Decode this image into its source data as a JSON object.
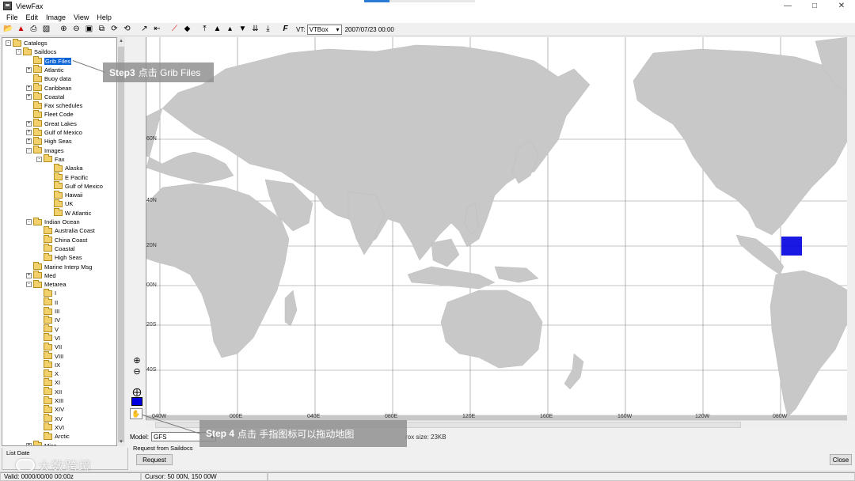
{
  "window": {
    "title": "ViewFax",
    "controls": {
      "minimize": "—",
      "maximize": "□",
      "close": "✕"
    }
  },
  "menu": [
    "File",
    "Edit",
    "Image",
    "View",
    "Help"
  ],
  "toolbar": {
    "icons": [
      "open-icon",
      "fax-icon",
      "print-icon",
      "delete-icon",
      "zoom-in-icon",
      "zoom-out-icon",
      "zoom-fit-icon",
      "copy-icon",
      "rotate-icon",
      "refresh-icon",
      "cursor-icon",
      "left-edge-icon",
      "draw-line-icon",
      "diamond-icon",
      "top-align-icon",
      "mountain-icon",
      "triangle-up-icon",
      "triangle-down-icon",
      "double-down-icon",
      "bottom-align-icon",
      "font-icon"
    ],
    "vt_label": "VT:",
    "vt_value": "VTBox",
    "datetime": "2007/07/23 00:00"
  },
  "tree": [
    {
      "label": "Catalogs",
      "level": 0,
      "expander": "-",
      "open": true
    },
    {
      "label": "Saildocs",
      "level": 1,
      "expander": "-",
      "open": true
    },
    {
      "label": "Grib Files",
      "level": 2,
      "expander": "",
      "selected": true
    },
    {
      "label": "Atlantic",
      "level": 2,
      "expander": "+"
    },
    {
      "label": "Buoy data",
      "level": 2,
      "expander": ""
    },
    {
      "label": "Caribbean",
      "level": 2,
      "expander": "+"
    },
    {
      "label": "Coastal",
      "level": 2,
      "expander": "+"
    },
    {
      "label": "Fax schedules",
      "level": 2,
      "expander": ""
    },
    {
      "label": "Fleet Code",
      "level": 2,
      "expander": ""
    },
    {
      "label": "Great Lakes",
      "level": 2,
      "expander": "+"
    },
    {
      "label": "Gulf of Mexico",
      "level": 2,
      "expander": "+"
    },
    {
      "label": "High Seas",
      "level": 2,
      "expander": "+"
    },
    {
      "label": "Images",
      "level": 2,
      "expander": "-",
      "open": true
    },
    {
      "label": "Fax",
      "level": 3,
      "expander": "-",
      "open": true
    },
    {
      "label": "Alaska",
      "level": 4,
      "expander": ""
    },
    {
      "label": "E Pacific",
      "level": 4,
      "expander": ""
    },
    {
      "label": "Gulf of Mexico",
      "level": 4,
      "expander": ""
    },
    {
      "label": "Hawaii",
      "level": 4,
      "expander": ""
    },
    {
      "label": "UK",
      "level": 4,
      "expander": ""
    },
    {
      "label": "W Atlantic",
      "level": 4,
      "expander": ""
    },
    {
      "label": "Indian Ocean",
      "level": 2,
      "expander": "-",
      "open": true
    },
    {
      "label": "Australia Coast",
      "level": 3,
      "expander": ""
    },
    {
      "label": "China Coast",
      "level": 3,
      "expander": ""
    },
    {
      "label": "Coastal",
      "level": 3,
      "expander": ""
    },
    {
      "label": "High Seas",
      "level": 3,
      "expander": ""
    },
    {
      "label": "Marine Interp Msg",
      "level": 2,
      "expander": ""
    },
    {
      "label": "Med",
      "level": 2,
      "expander": "+"
    },
    {
      "label": "Metarea",
      "level": 2,
      "expander": "-",
      "open": true
    },
    {
      "label": "I",
      "level": 3,
      "expander": ""
    },
    {
      "label": "II",
      "level": 3,
      "expander": ""
    },
    {
      "label": "III",
      "level": 3,
      "expander": ""
    },
    {
      "label": "IV",
      "level": 3,
      "expander": ""
    },
    {
      "label": "V",
      "level": 3,
      "expander": ""
    },
    {
      "label": "VI",
      "level": 3,
      "expander": ""
    },
    {
      "label": "VII",
      "level": 3,
      "expander": ""
    },
    {
      "label": "VIII",
      "level": 3,
      "expander": ""
    },
    {
      "label": "IX",
      "level": 3,
      "expander": ""
    },
    {
      "label": "X",
      "level": 3,
      "expander": ""
    },
    {
      "label": "XI",
      "level": 3,
      "expander": ""
    },
    {
      "label": "XII",
      "level": 3,
      "expander": ""
    },
    {
      "label": "XIII",
      "level": 3,
      "expander": ""
    },
    {
      "label": "XIV",
      "level": 3,
      "expander": ""
    },
    {
      "label": "XV",
      "level": 3,
      "expander": ""
    },
    {
      "label": "XVI",
      "level": 3,
      "expander": ""
    },
    {
      "label": "Arctic",
      "level": 3,
      "expander": ""
    },
    {
      "label": "Misc",
      "level": 2,
      "expander": "+"
    }
  ],
  "map": {
    "lat_labels": [
      "60N",
      "40N",
      "20N",
      "00N",
      "20S",
      "40S"
    ],
    "lon_labels": [
      "040W",
      "000E",
      "040E",
      "080E",
      "120E",
      "160E",
      "160W",
      "120W",
      "080W"
    ],
    "land_color": "#c8c8c8",
    "selection_color": "#0000e0"
  },
  "bottom": {
    "model_label": "Model:",
    "model_value": "GFS",
    "size_text": "rox size: 23KB",
    "request_group_title": "Request from Saildocs",
    "request_button": "Request",
    "close_button": "Close",
    "list_date_label": "List Date"
  },
  "status": {
    "valid": "Valid: 0000/00/00 00:00z",
    "cursor": "Cursor: 50 00N, 150 00W"
  },
  "annotations": {
    "step3": {
      "bold": "Step3",
      "text": "点击 Grib Files"
    },
    "step4": {
      "bold": "Step 4",
      "text": "点击 手指图标可以拖动地图"
    }
  },
  "watermark": "大数跨境"
}
